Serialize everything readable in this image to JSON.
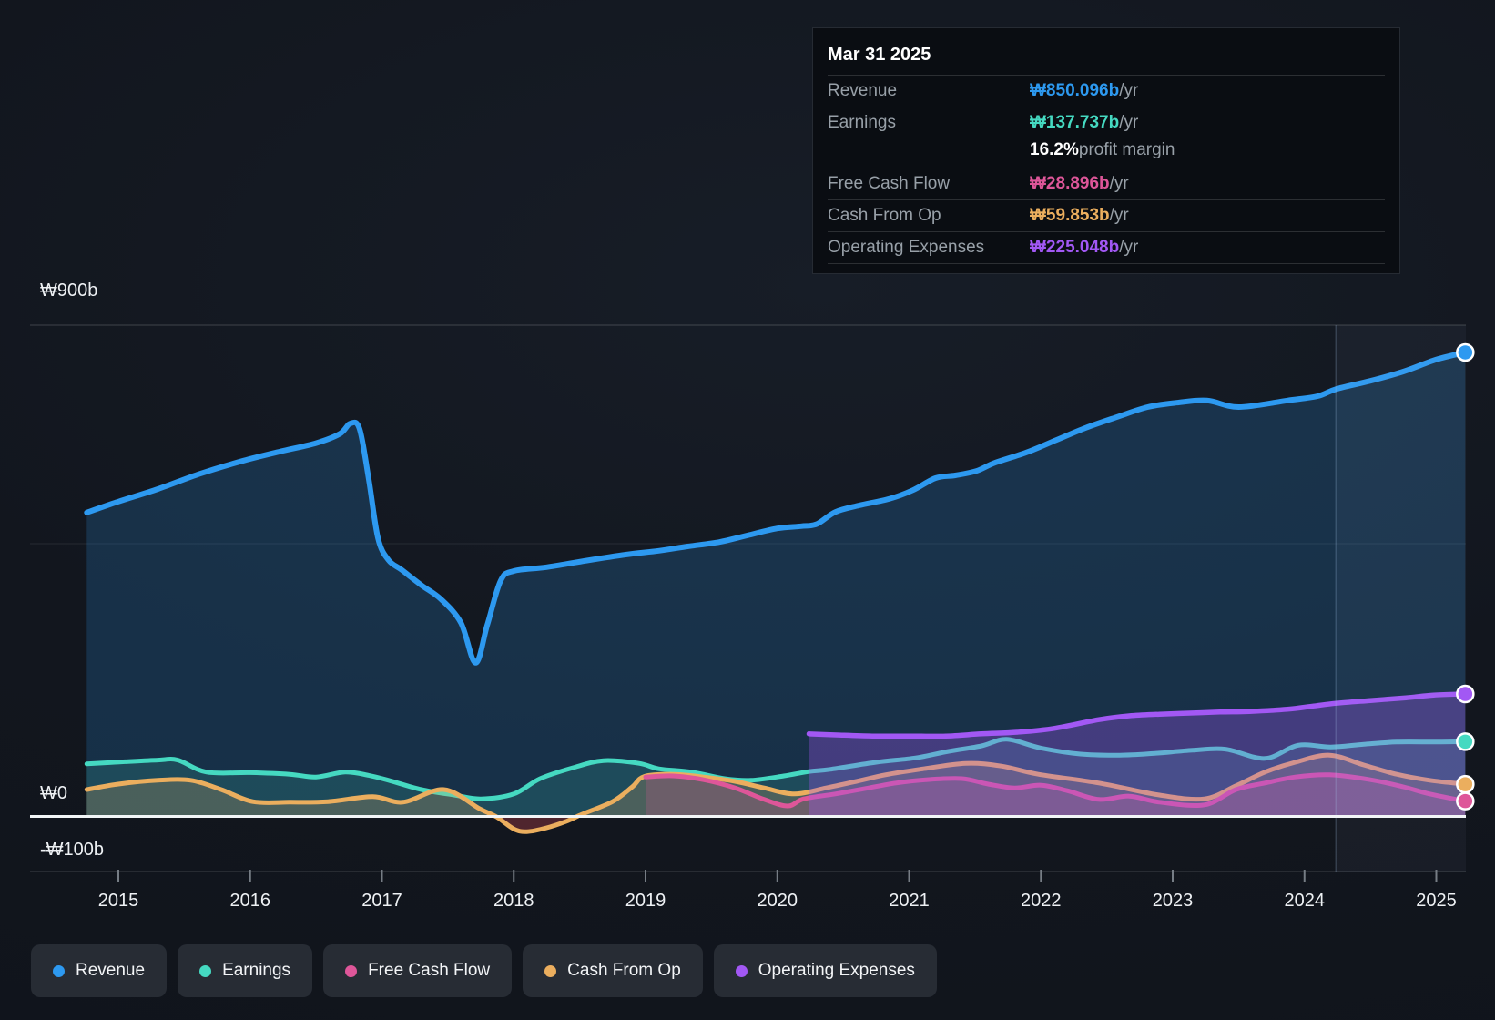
{
  "tooltip": {
    "date": "Mar 31 2025",
    "rows": [
      {
        "key": "revenue",
        "label": "Revenue",
        "value": "₩850.096b",
        "suffix": " /yr"
      },
      {
        "key": "earnings",
        "label": "Earnings",
        "value": "₩137.737b",
        "suffix": " /yr",
        "sub_bold": "16.2%",
        "sub_text": " profit margin"
      },
      {
        "key": "fcf",
        "label": "Free Cash Flow",
        "value": "₩28.896b",
        "suffix": " /yr"
      },
      {
        "key": "cashop",
        "label": "Cash From Op",
        "value": "₩59.853b",
        "suffix": " /yr"
      },
      {
        "key": "opex",
        "label": "Operating Expenses",
        "value": "₩225.048b",
        "suffix": " /yr"
      }
    ]
  },
  "legend": {
    "items": [
      {
        "key": "revenue",
        "label": "Revenue"
      },
      {
        "key": "earnings",
        "label": "Earnings"
      },
      {
        "key": "fcf",
        "label": "Free Cash Flow"
      },
      {
        "key": "cashop",
        "label": "Cash From Op"
      },
      {
        "key": "opex",
        "label": "Operating Expenses"
      }
    ]
  },
  "colors": {
    "revenue": "#2d99f0",
    "earnings": "#45d9c1",
    "fcf": "#de5699",
    "cashop": "#ebae5e",
    "opex": "#a258f4",
    "negative_fill": "rgba(207,70,80,0.32)"
  },
  "axes": {
    "y_ticks": [
      {
        "label": "₩900b",
        "value": 900
      },
      {
        "label": "₩0",
        "value": 0
      },
      {
        "label": "-₩100b",
        "value": -100
      }
    ],
    "mid_gridline_value": 500,
    "x_ticks": [
      "2015",
      "2016",
      "2017",
      "2018",
      "2019",
      "2020",
      "2021",
      "2022",
      "2023",
      "2024",
      "2025"
    ]
  },
  "chart_data": {
    "type": "area",
    "title": "Financial history: revenue, earnings, cash flow and operating expenses",
    "x_unit": "year",
    "y_unit": "₩ billions",
    "x_range": [
      2014.33,
      2025.22
    ],
    "y_range": [
      -100,
      900
    ],
    "grid": "horizontal",
    "legend_position": "bottom",
    "highlight_from_year": 2024.24,
    "series": [
      {
        "name": "Revenue",
        "key": "revenue",
        "points": [
          [
            2014.76,
            557
          ],
          [
            2015.0,
            577
          ],
          [
            2015.3,
            600
          ],
          [
            2015.62,
            628
          ],
          [
            2015.95,
            652
          ],
          [
            2016.25,
            670
          ],
          [
            2016.5,
            684
          ],
          [
            2016.68,
            701
          ],
          [
            2016.76,
            720
          ],
          [
            2016.83,
            710
          ],
          [
            2016.9,
            618
          ],
          [
            2016.97,
            510
          ],
          [
            2017.05,
            470
          ],
          [
            2017.15,
            452
          ],
          [
            2017.3,
            424
          ],
          [
            2017.45,
            398
          ],
          [
            2017.6,
            355
          ],
          [
            2017.71,
            282
          ],
          [
            2017.8,
            352
          ],
          [
            2017.9,
            432
          ],
          [
            2018.0,
            450
          ],
          [
            2018.25,
            457
          ],
          [
            2018.55,
            469
          ],
          [
            2018.85,
            480
          ],
          [
            2019.1,
            487
          ],
          [
            2019.32,
            495
          ],
          [
            2019.56,
            503
          ],
          [
            2019.77,
            515
          ],
          [
            2020.0,
            528
          ],
          [
            2020.18,
            532
          ],
          [
            2020.3,
            536
          ],
          [
            2020.44,
            558
          ],
          [
            2020.62,
            570
          ],
          [
            2020.85,
            582
          ],
          [
            2021.03,
            598
          ],
          [
            2021.2,
            620
          ],
          [
            2021.35,
            625
          ],
          [
            2021.51,
            633
          ],
          [
            2021.65,
            648
          ],
          [
            2021.89,
            667
          ],
          [
            2022.12,
            690
          ],
          [
            2022.34,
            712
          ],
          [
            2022.58,
            732
          ],
          [
            2022.81,
            750
          ],
          [
            2023.03,
            758
          ],
          [
            2023.26,
            762
          ],
          [
            2023.5,
            750
          ],
          [
            2023.87,
            762
          ],
          [
            2024.1,
            770
          ],
          [
            2024.24,
            783
          ],
          [
            2024.5,
            798
          ],
          [
            2024.75,
            815
          ],
          [
            2025.0,
            837
          ],
          [
            2025.22,
            850.096
          ]
        ]
      },
      {
        "name": "Earnings",
        "key": "earnings",
        "points": [
          [
            2014.76,
            97
          ],
          [
            2015.05,
            101
          ],
          [
            2015.3,
            104
          ],
          [
            2015.45,
            104
          ],
          [
            2015.67,
            82
          ],
          [
            2016.0,
            81
          ],
          [
            2016.3,
            78
          ],
          [
            2016.5,
            73
          ],
          [
            2016.72,
            82
          ],
          [
            2016.9,
            76
          ],
          [
            2017.05,
            67
          ],
          [
            2017.3,
            50
          ],
          [
            2017.55,
            40
          ],
          [
            2017.75,
            33
          ],
          [
            2018.0,
            42
          ],
          [
            2018.2,
            70
          ],
          [
            2018.45,
            90
          ],
          [
            2018.68,
            103
          ],
          [
            2018.95,
            98
          ],
          [
            2019.1,
            88
          ],
          [
            2019.35,
            82
          ],
          [
            2019.6,
            70
          ],
          [
            2019.8,
            67
          ],
          [
            2020.05,
            75
          ],
          [
            2020.24,
            83
          ],
          [
            2020.4,
            87
          ],
          [
            2020.75,
            100
          ],
          [
            2021.05,
            108
          ],
          [
            2021.3,
            120
          ],
          [
            2021.55,
            130
          ],
          [
            2021.74,
            142
          ],
          [
            2022.0,
            126
          ],
          [
            2022.3,
            115
          ],
          [
            2022.6,
            113
          ],
          [
            2022.85,
            116
          ],
          [
            2023.15,
            122
          ],
          [
            2023.4,
            124
          ],
          [
            2023.7,
            107
          ],
          [
            2023.95,
            131
          ],
          [
            2024.2,
            128
          ],
          [
            2024.45,
            133
          ],
          [
            2024.7,
            137
          ],
          [
            2025.0,
            137
          ],
          [
            2025.22,
            137.737
          ]
        ]
      },
      {
        "name": "Cash From Op",
        "key": "cashop",
        "points": [
          [
            2014.76,
            50
          ],
          [
            2015.0,
            60
          ],
          [
            2015.3,
            67
          ],
          [
            2015.55,
            67
          ],
          [
            2015.78,
            50
          ],
          [
            2016.02,
            28
          ],
          [
            2016.3,
            27
          ],
          [
            2016.59,
            28
          ],
          [
            2016.93,
            37
          ],
          [
            2017.16,
            27
          ],
          [
            2017.47,
            50
          ],
          [
            2017.74,
            15
          ],
          [
            2017.87,
            0
          ],
          [
            2018.0,
            -22
          ],
          [
            2018.1,
            -27
          ],
          [
            2018.25,
            -20
          ],
          [
            2018.4,
            -8
          ],
          [
            2018.52,
            5
          ],
          [
            2018.75,
            28
          ],
          [
            2018.9,
            55
          ],
          [
            2018.99,
            74
          ],
          [
            2019.21,
            78
          ],
          [
            2019.44,
            73
          ],
          [
            2019.68,
            65
          ],
          [
            2019.9,
            53
          ],
          [
            2020.13,
            42
          ],
          [
            2020.37,
            53
          ],
          [
            2020.6,
            65
          ],
          [
            2020.82,
            77
          ],
          [
            2021.08,
            87
          ],
          [
            2021.43,
            98
          ],
          [
            2021.7,
            93
          ],
          [
            2021.98,
            78
          ],
          [
            2022.44,
            62
          ],
          [
            2022.9,
            40
          ],
          [
            2023.24,
            33
          ],
          [
            2023.48,
            57
          ],
          [
            2023.7,
            82
          ],
          [
            2023.93,
            100
          ],
          [
            2024.19,
            113
          ],
          [
            2024.45,
            95
          ],
          [
            2024.7,
            78
          ],
          [
            2024.95,
            67
          ],
          [
            2025.22,
            59.853
          ]
        ]
      },
      {
        "name": "Free Cash Flow",
        "key": "fcf",
        "points": [
          [
            2019.0,
            73
          ],
          [
            2019.21,
            75
          ],
          [
            2019.44,
            68
          ],
          [
            2019.68,
            53
          ],
          [
            2019.9,
            32
          ],
          [
            2020.08,
            20
          ],
          [
            2020.2,
            33
          ],
          [
            2020.44,
            42
          ],
          [
            2020.67,
            52
          ],
          [
            2020.9,
            62
          ],
          [
            2021.13,
            68
          ],
          [
            2021.4,
            70
          ],
          [
            2021.6,
            60
          ],
          [
            2021.8,
            53
          ],
          [
            2022.0,
            58
          ],
          [
            2022.2,
            48
          ],
          [
            2022.44,
            32
          ],
          [
            2022.67,
            38
          ],
          [
            2022.9,
            27
          ],
          [
            2023.24,
            22
          ],
          [
            2023.48,
            50
          ],
          [
            2023.7,
            62
          ],
          [
            2023.93,
            73
          ],
          [
            2024.19,
            77
          ],
          [
            2024.5,
            68
          ],
          [
            2024.75,
            55
          ],
          [
            2024.95,
            42
          ],
          [
            2025.22,
            28.896
          ]
        ]
      },
      {
        "name": "Operating Expenses",
        "key": "opex",
        "points": [
          [
            2020.24,
            152
          ],
          [
            2020.45,
            150
          ],
          [
            2020.72,
            148
          ],
          [
            2021.0,
            148
          ],
          [
            2021.28,
            148
          ],
          [
            2021.55,
            152
          ],
          [
            2021.82,
            155
          ],
          [
            2022.1,
            162
          ],
          [
            2022.44,
            178
          ],
          [
            2022.67,
            185
          ],
          [
            2022.9,
            188
          ],
          [
            2023.13,
            190
          ],
          [
            2023.36,
            192
          ],
          [
            2023.58,
            193
          ],
          [
            2023.87,
            197
          ],
          [
            2024.07,
            203
          ],
          [
            2024.24,
            208
          ],
          [
            2024.5,
            213
          ],
          [
            2024.77,
            218
          ],
          [
            2024.98,
            223
          ],
          [
            2025.22,
            225.048
          ]
        ]
      }
    ]
  }
}
